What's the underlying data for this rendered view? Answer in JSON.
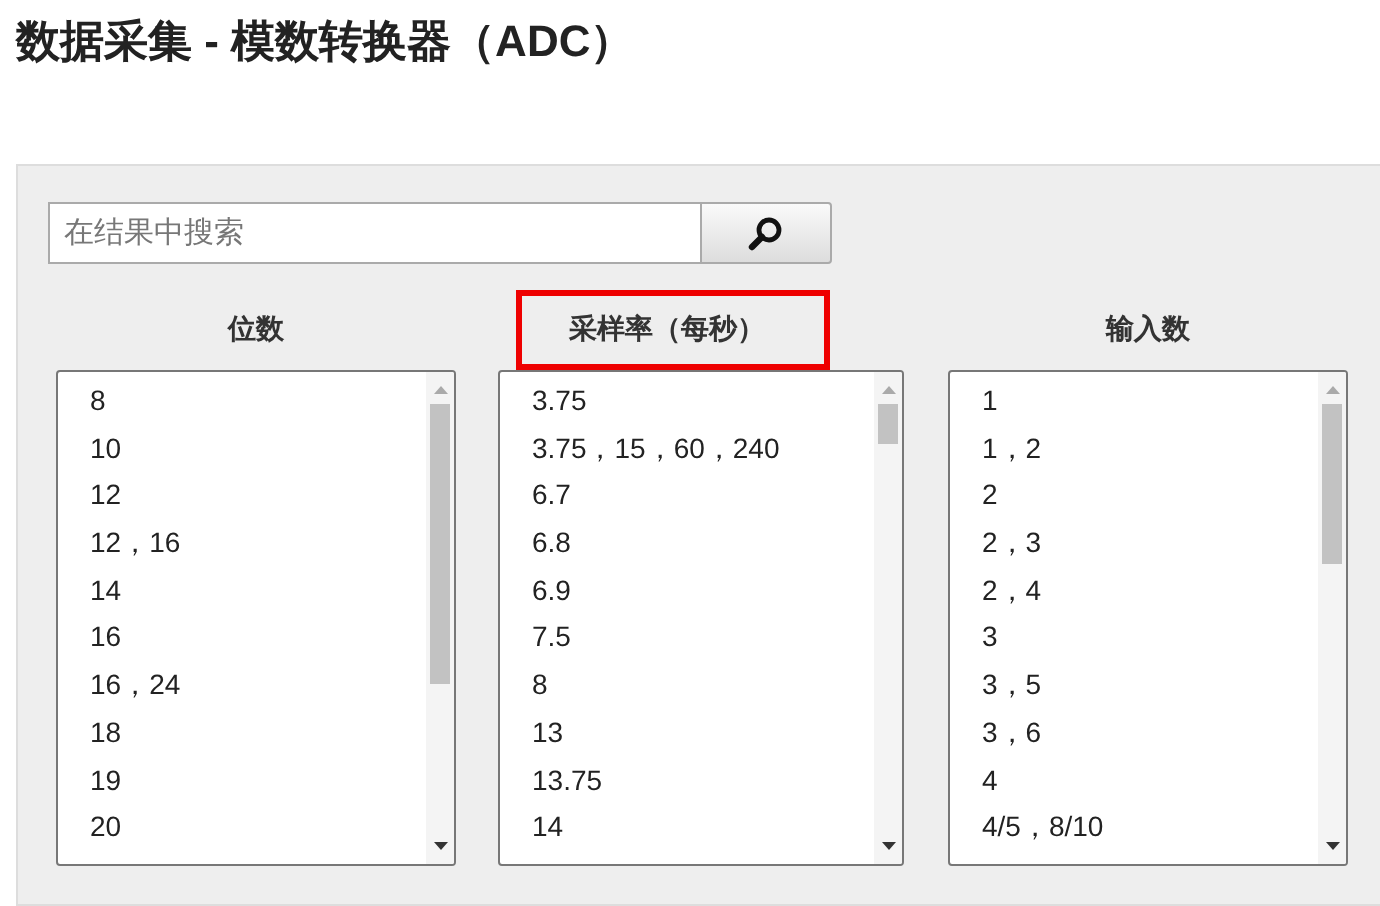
{
  "page": {
    "title": "数据采集 - 模数转换器（ADC）"
  },
  "search": {
    "placeholder": "在结果中搜索"
  },
  "filters": [
    {
      "heading": "位数",
      "highlighted": false,
      "options": [
        "8",
        "10",
        "12",
        "12，16",
        "14",
        "16",
        "16，24",
        "18",
        "19",
        "20"
      ]
    },
    {
      "heading": "采样率（每秒）",
      "highlighted": true,
      "options": [
        "3.75",
        "3.75，15，60，240",
        "6.7",
        "6.8",
        "6.9",
        "7.5",
        "8",
        "13",
        "13.75",
        "14"
      ]
    },
    {
      "heading": "输入数",
      "highlighted": false,
      "options": [
        "1",
        "1，2",
        "2",
        "2，3",
        "2，4",
        "3",
        "3，5",
        "3，6",
        "4",
        "4/5，8/10"
      ]
    }
  ]
}
